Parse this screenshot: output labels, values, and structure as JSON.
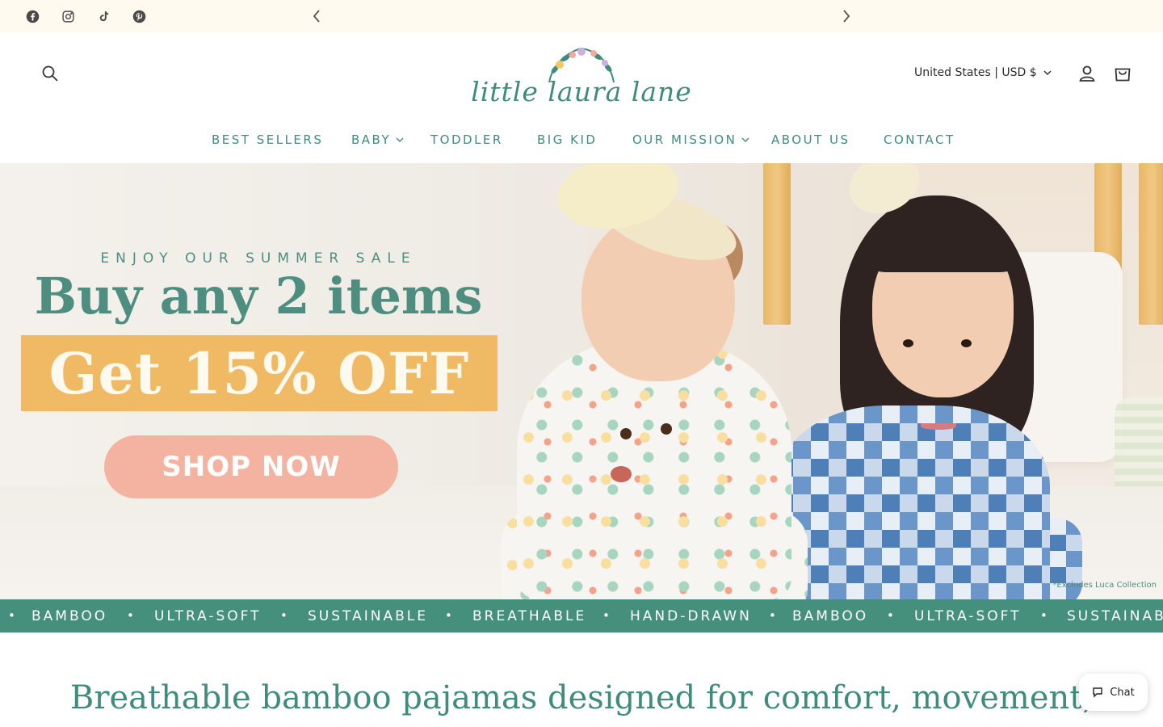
{
  "announcement": {
    "text": "",
    "prev_icon": "chevron-left-icon",
    "next_icon": "chevron-right-icon"
  },
  "social": [
    {
      "name": "facebook-icon"
    },
    {
      "name": "instagram-icon"
    },
    {
      "name": "tiktok-icon"
    },
    {
      "name": "pinterest-icon"
    }
  ],
  "header": {
    "logo_text": "little laura lane",
    "country_selector": "United States | USD $",
    "icons": [
      "search-icon",
      "account-icon",
      "cart-icon"
    ]
  },
  "nav": {
    "items": [
      {
        "label": "BEST SELLERS",
        "has_dropdown": false
      },
      {
        "label": "BABY",
        "has_dropdown": true
      },
      {
        "label": "TODDLER",
        "has_dropdown": false
      },
      {
        "label": "BIG KID",
        "has_dropdown": false
      },
      {
        "label": "OUR MISSION",
        "has_dropdown": true
      },
      {
        "label": "ABOUT US",
        "has_dropdown": false
      },
      {
        "label": "CONTACT",
        "has_dropdown": false
      }
    ]
  },
  "hero": {
    "kicker": "ENJOY OUR SUMMER SALE",
    "headline": "Buy any 2 items",
    "promo": "Get 15% OFF",
    "cta": "SHOP NOW",
    "disclaimer": "*Excludes Luca Collection"
  },
  "marquee": {
    "items": [
      "BAMBOO",
      "ULTRA-SOFT",
      "SUSTAINABLE",
      "BREATHABLE",
      "HAND-DRAWN",
      "BAMBOO",
      "ULTRA-SOFT",
      "SUSTAINAB"
    ],
    "separator": "•"
  },
  "intro": {
    "text": "Breathable bamboo pajamas designed for comfort, movement,"
  },
  "chat": {
    "label": "Chat",
    "icon": "chat-bubble-icon"
  },
  "colors": {
    "brand_green": "#3f8c7d",
    "marquee_bg": "#44907c",
    "promo_yellow": "#efba63",
    "cta_pink": "#f4b3a1",
    "topbar_bg": "#fffaf0"
  }
}
